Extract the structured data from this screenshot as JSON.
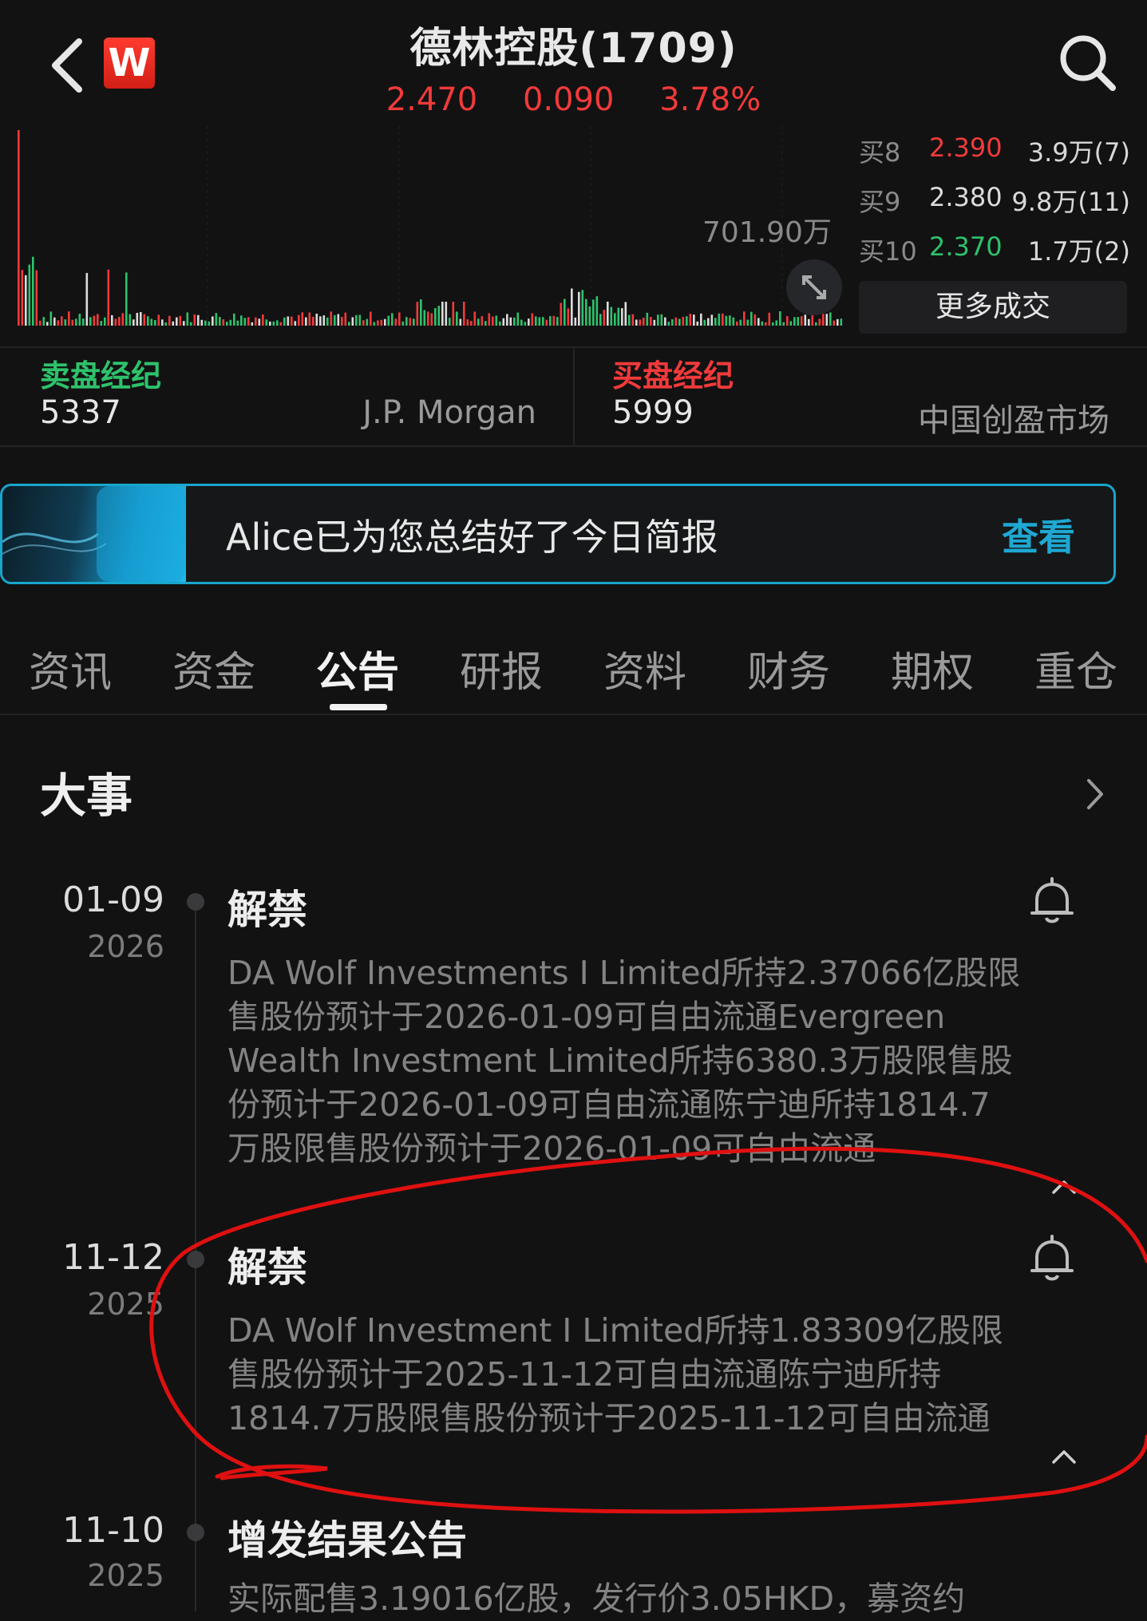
{
  "header": {
    "title": "德林控股(1709)",
    "price": "2.470",
    "change": "0.090",
    "change_pct": "3.78%",
    "logo_letter": "W"
  },
  "chart": {
    "max_label": "701.90万"
  },
  "order_book": [
    {
      "label": "买8",
      "price": "2.390",
      "price_color": "#f23a3a",
      "volume": "3.9万(7)"
    },
    {
      "label": "买9",
      "price": "2.380",
      "price_color": "#dcdcdc",
      "volume": "9.8万(11)"
    },
    {
      "label": "买10",
      "price": "2.370",
      "price_color": "#2ec26b",
      "volume": "1.7万(2)"
    }
  ],
  "more_deals_label": "更多成交",
  "brokers": {
    "sell_title": "卖盘经纪",
    "sell_code": "5337",
    "sell_name": "J.P. Morgan",
    "buy_title": "买盘经纪",
    "buy_code": "5999",
    "buy_name": "中国创盈市场"
  },
  "banner": {
    "text": "Alice已为您总结好了今日简报",
    "link": "查看"
  },
  "tabs": [
    "资讯",
    "资金",
    "公告",
    "研报",
    "资料",
    "财务",
    "期权",
    "重仓"
  ],
  "active_tab": "公告",
  "section": {
    "title": "大事"
  },
  "events": [
    {
      "date": "01-09",
      "year": "2026",
      "title": "解禁",
      "lines": [
        "DA Wolf Investments I Limited所持2.37066亿股限",
        "售股份预计于2026-01-09可自由流通Evergreen",
        "Wealth Investment Limited所持6380.3万股限售股",
        "份预计于2026-01-09可自由流通陈宁迪所持1814.7",
        "万股限售股份预计于2026-01-09可自由流通"
      ]
    },
    {
      "date": "11-12",
      "year": "2025",
      "title": "解禁",
      "lines": [
        "DA Wolf Investment I Limited所持1.83309亿股限",
        "售股份预计于2025-11-12可自由流通陈宁迪所持",
        "1814.7万股限售股份预计于2025-11-12可自由流通"
      ]
    },
    {
      "date": "11-10",
      "year": "2025",
      "title": "增发结果公告",
      "lines": [
        "实际配售3.19016亿股，发行价3.05HKD，募资约"
      ]
    }
  ],
  "colors": {
    "up": "#f23a3a",
    "down": "#2ec26b",
    "accent": "#1ea8d2",
    "annotation": "#e01010"
  },
  "icons": [
    "back-chevron-icon",
    "search-icon",
    "expand-icon",
    "bell-icon",
    "chevron-up-icon",
    "chevron-right-icon"
  ]
}
